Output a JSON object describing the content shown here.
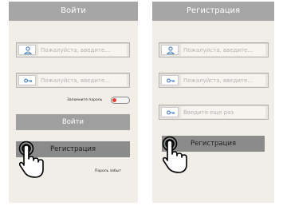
{
  "login": {
    "title": "Войти",
    "username_placeholder": "Пожалуйста, введите...",
    "password_placeholder": "Пожалуйста, введите...",
    "remember_label": "Запомните пароль",
    "remember_on": false,
    "login_button": "Войти",
    "register_button": "Регистрация",
    "forgot_link": "Пароль забыт"
  },
  "register": {
    "title": "Регистрация",
    "username_placeholder": "Пожалуйста, введите...",
    "password_placeholder": "Пожалуйста, введите...",
    "confirm_placeholder": "Введите еще раз",
    "register_button": "Регистрация"
  },
  "icons": {
    "user": "user-icon",
    "key": "key-icon",
    "hand": "pointing-hand-icon"
  },
  "colors": {
    "titlebar": "#a6a6a6",
    "background": "#f1eee8",
    "button": "#9f9f9f",
    "button_pressed": "#8b8b8b",
    "icon_blue": "#4a7fc1",
    "toggle_red": "#e53b2c"
  }
}
